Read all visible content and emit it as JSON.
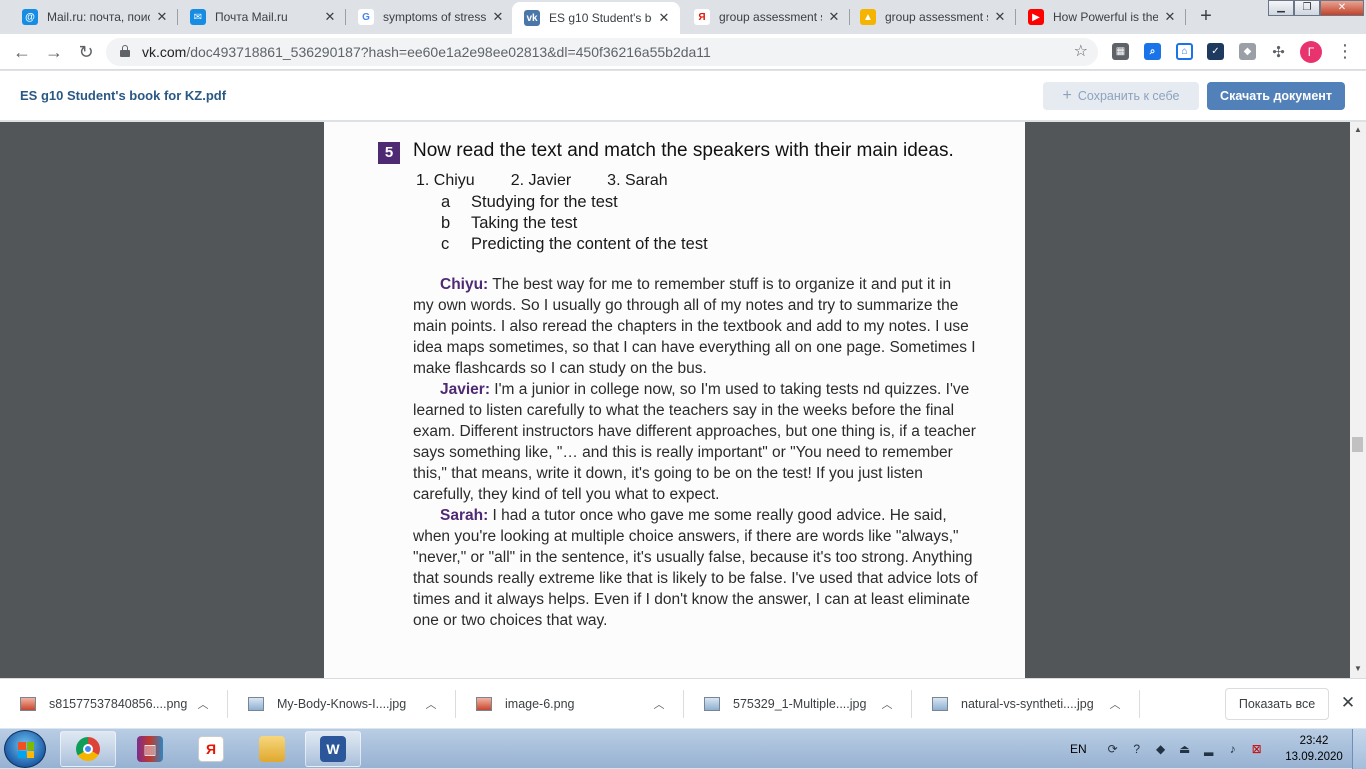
{
  "browser": {
    "tabs": [
      {
        "title": "Mail.ru: почта, поис",
        "icon": "mailru-icon",
        "color": "#168de2",
        "glyph": "@"
      },
      {
        "title": "Почта Mail.ru",
        "icon": "mail-envelope-icon",
        "color": "#168de2",
        "glyph": "✉"
      },
      {
        "title": "symptoms of stress",
        "icon": "google-icon",
        "color": "#ffffff",
        "glyph": "G"
      },
      {
        "title": "ES g10 Student's bo",
        "icon": "vk-icon",
        "color": "#4a76a8",
        "glyph": "vk",
        "active": true
      },
      {
        "title": "group assessment s",
        "icon": "yandex-icon",
        "color": "#ffffff",
        "glyph": "Я"
      },
      {
        "title": "group assessment s",
        "icon": "image-icon",
        "color": "#f5b400",
        "glyph": "▲"
      },
      {
        "title": "How Powerful is the",
        "icon": "youtube-icon",
        "color": "#ff0000",
        "glyph": "▶"
      }
    ],
    "new_tab_label": "+",
    "url_host": "vk.com",
    "url_rest": "/doc493718861_536290187?hash=ee60e1a2e98ee02813&dl=450f36216a55b2da11",
    "profile_initial": "Г"
  },
  "doc_header": {
    "file_name": "ES g10 Student's book for KZ.pdf",
    "save_label": "Сохранить к себе",
    "download_label": "Скачать документ"
  },
  "page": {
    "exercise_number": "5",
    "exercise_title": "Now read the text and match the speakers with their main ideas.",
    "speakers": [
      "1.  Chiyu",
      "2. Javier",
      "3. Sarah"
    ],
    "ideas": [
      {
        "letter": "a",
        "text": "Studying for the test"
      },
      {
        "letter": "b",
        "text": "Taking the test"
      },
      {
        "letter": "c",
        "text": "Predicting the content of the test"
      }
    ],
    "paragraphs": [
      {
        "speaker": "Chiyu:",
        "lines": [
          " The best way for me to remember stuff is to organize it and put it in",
          "my own words. So I usually go through all of my notes and try to summarize the",
          "main points. I also reread the chapters in the textbook and add to my notes. I use",
          "idea maps sometimes, so that I can have everything all on one page. Sometimes I",
          "make flashcards so I can study on the bus."
        ]
      },
      {
        "speaker": "Javier:",
        "lines": [
          " I'm a junior in college now, so I'm used to taking tests nd quizzes. I've",
          "learned to listen carefully to what the teachers say in the weeks before the final",
          "exam. Different instructors have different approaches, but one thing is, if a teacher",
          "says something like, \"… and this is really important\" or \"You need to remember",
          "this,\" that means, write it down, it's going to be on the test! If you just listen",
          "carefully, they kind of tell you what to expect."
        ]
      },
      {
        "speaker": "Sarah:",
        "lines": [
          " I had a tutor once who gave me some really good advice. He said,",
          "when you're looking at multiple choice answers, if there are words like \"always,\"",
          "\"never,\" or \"all\" in the sentence, it's usually false, because it's too strong. Anything",
          "that sounds really extreme like that is likely to be false. I've used that advice lots of",
          "times and it always helps. Even if I don't know the answer, I can at least eliminate",
          "one or two choices that way."
        ]
      }
    ]
  },
  "downloads": {
    "items": [
      {
        "name": "s81577537840856....png",
        "icon": "red"
      },
      {
        "name": "My-Body-Knows-I....jpg",
        "icon": "blue"
      },
      {
        "name": "image-6.png",
        "icon": "red"
      },
      {
        "name": "575329_1-Multiple....jpg",
        "icon": "blue"
      },
      {
        "name": "natural-vs-syntheti....jpg",
        "icon": "blue"
      }
    ],
    "show_all_label": "Показать все"
  },
  "taskbar": {
    "language": "EN",
    "time": "23:42",
    "date": "13.09.2020"
  },
  "colors": {
    "speaker_accent": "#4e2a73",
    "vk_link": "#2a5885",
    "vk_button": "#5181b8"
  }
}
